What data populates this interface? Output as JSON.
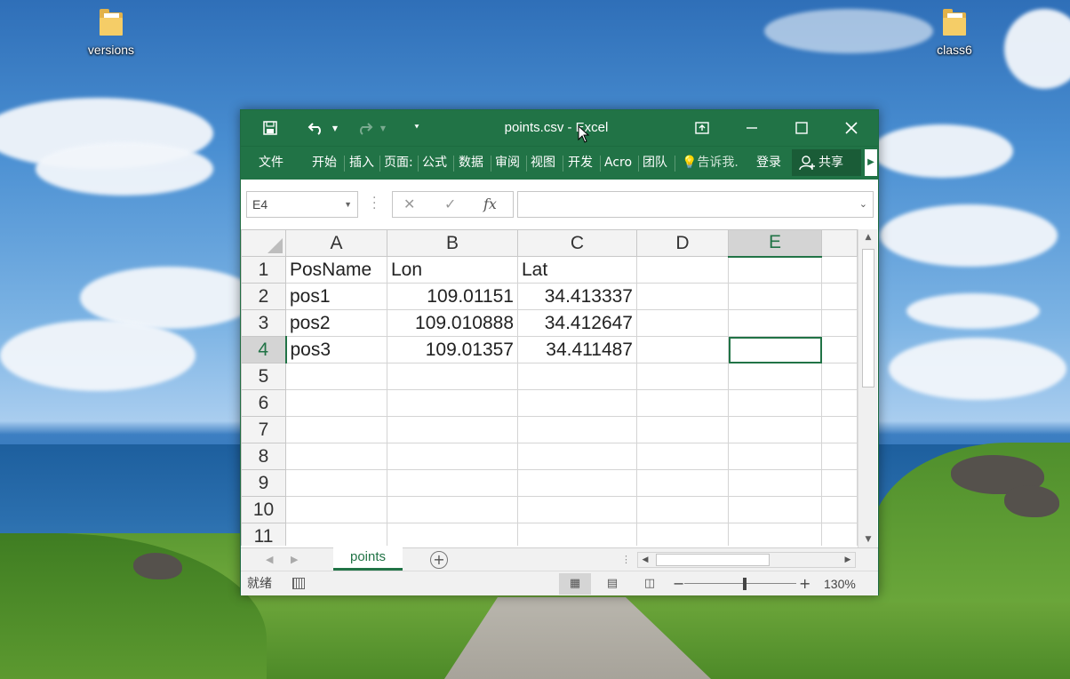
{
  "desktop": {
    "icons": [
      {
        "label": "versions"
      },
      {
        "label": "class6"
      }
    ]
  },
  "window": {
    "title": "points.csv - Excel",
    "quick_access": {
      "save": "save-icon",
      "undo": "undo-icon",
      "redo": "redo-icon",
      "customize": "customize-icon"
    },
    "controls": {
      "restore_ribbon": "ribbon-display-icon",
      "minimize": "minimize-icon",
      "maximize": "maximize-icon",
      "close": "close-icon"
    },
    "colors": {
      "brand": "#217346",
      "selection": "#217346"
    }
  },
  "ribbon": {
    "tabs": [
      "文件",
      "开始",
      "插入",
      "页面:",
      "公式",
      "数据",
      "审阅",
      "视图",
      "开发",
      "Acro",
      "团队"
    ],
    "tell_me": "告诉我.",
    "sign_in": "登录",
    "share": "共享"
  },
  "formula_bar": {
    "name_box": "E4",
    "cancel": "✕",
    "enter": "✓",
    "fx": "fx",
    "value": ""
  },
  "sheet": {
    "columns": [
      "A",
      "B",
      "C",
      "D",
      "E"
    ],
    "rows": [
      {
        "num": "1",
        "cells": [
          "PosName",
          "Lon",
          "Lat",
          "",
          ""
        ]
      },
      {
        "num": "2",
        "cells": [
          "pos1",
          "109.01151",
          "34.413337",
          "",
          ""
        ]
      },
      {
        "num": "3",
        "cells": [
          "pos2",
          "109.010888",
          "34.412647",
          "",
          ""
        ]
      },
      {
        "num": "4",
        "cells": [
          "pos3",
          "109.01357",
          "34.411487",
          "",
          ""
        ]
      },
      {
        "num": "5",
        "cells": [
          "",
          "",
          "",
          "",
          ""
        ]
      },
      {
        "num": "6",
        "cells": [
          "",
          "",
          "",
          "",
          ""
        ]
      },
      {
        "num": "7",
        "cells": [
          "",
          "",
          "",
          "",
          ""
        ]
      },
      {
        "num": "8",
        "cells": [
          "",
          "",
          "",
          "",
          ""
        ]
      },
      {
        "num": "9",
        "cells": [
          "",
          "",
          "",
          "",
          ""
        ]
      },
      {
        "num": "10",
        "cells": [
          "",
          "",
          "",
          "",
          ""
        ]
      },
      {
        "num": "11",
        "cells": [
          "",
          "",
          "",
          "",
          ""
        ]
      }
    ],
    "active_cell": "E4",
    "tab_name": "points"
  },
  "status": {
    "mode": "就绪",
    "zoom": "130%",
    "zoom_minus": "−",
    "zoom_plus": "+"
  }
}
